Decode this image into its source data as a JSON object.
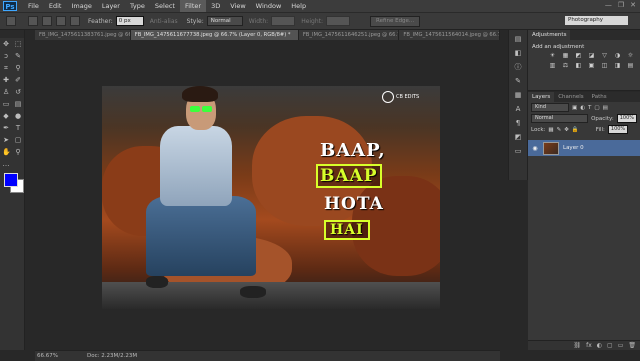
{
  "menubar": {
    "logo": "Ps",
    "items": [
      "File",
      "Edit",
      "Image",
      "Layer",
      "Type",
      "Select",
      "Filter",
      "3D",
      "View",
      "Window",
      "Help"
    ],
    "active_index": 6,
    "window_controls": [
      "—",
      "❐",
      "✕"
    ]
  },
  "options": {
    "feather_label": "Feather:",
    "feather_value": "0 px",
    "antialias_label": "Anti-alias",
    "style_label": "Style:",
    "style_value": "Normal",
    "width_label": "Width:",
    "height_label": "Height:",
    "refine_button": "Refine Edge...",
    "workspace": "Photography"
  },
  "tabs": [
    {
      "label": "FB_IMG_1475611383761.jpeg @ 66.7% ...",
      "active": false
    },
    {
      "label": "FB_IMG_1475611677738.jpeg @ 66.7% (Layer 0, RGB/8#) *",
      "active": true
    },
    {
      "label": "FB_IMG_1475611646251.jpeg @ 66.7%...",
      "active": false
    },
    {
      "label": "FB_IMG_1475611564014.jpeg @ 66.7%...",
      "active": false
    }
  ],
  "photo": {
    "watermark": "CB EDITS",
    "line1": "BAAP,",
    "line2": "BAAP",
    "line3": "HOTA",
    "line4": "HAI"
  },
  "status": {
    "zoom": "66.67%",
    "doc": "Doc: 2.23M/2.23M"
  },
  "adjustments": {
    "tabs": [
      "Adjustments"
    ],
    "title": "Add an adjustment",
    "row1": [
      "☀",
      "▦",
      "◩",
      "◪",
      "▽",
      "◑",
      "☼"
    ],
    "row2": [
      "▥",
      "⚖",
      "◧",
      "▣",
      "◫",
      "◨",
      "▤"
    ]
  },
  "layers": {
    "tabs": [
      "Layers",
      "Channels",
      "Paths"
    ],
    "kind_label": "Kind",
    "blend_mode": "Normal",
    "opacity_label": "Opacity:",
    "opacity_value": "100%",
    "lock_label": "Lock:",
    "fill_label": "Fill:",
    "fill_value": "100%",
    "layer_name": "Layer 0",
    "footer_icons": [
      "⛓",
      "fx",
      "◐",
      "▢",
      "▭",
      "🗑"
    ]
  },
  "colors": {
    "foreground": "#0000ff",
    "background": "#ffffff",
    "accent": "#4a6a9a"
  }
}
